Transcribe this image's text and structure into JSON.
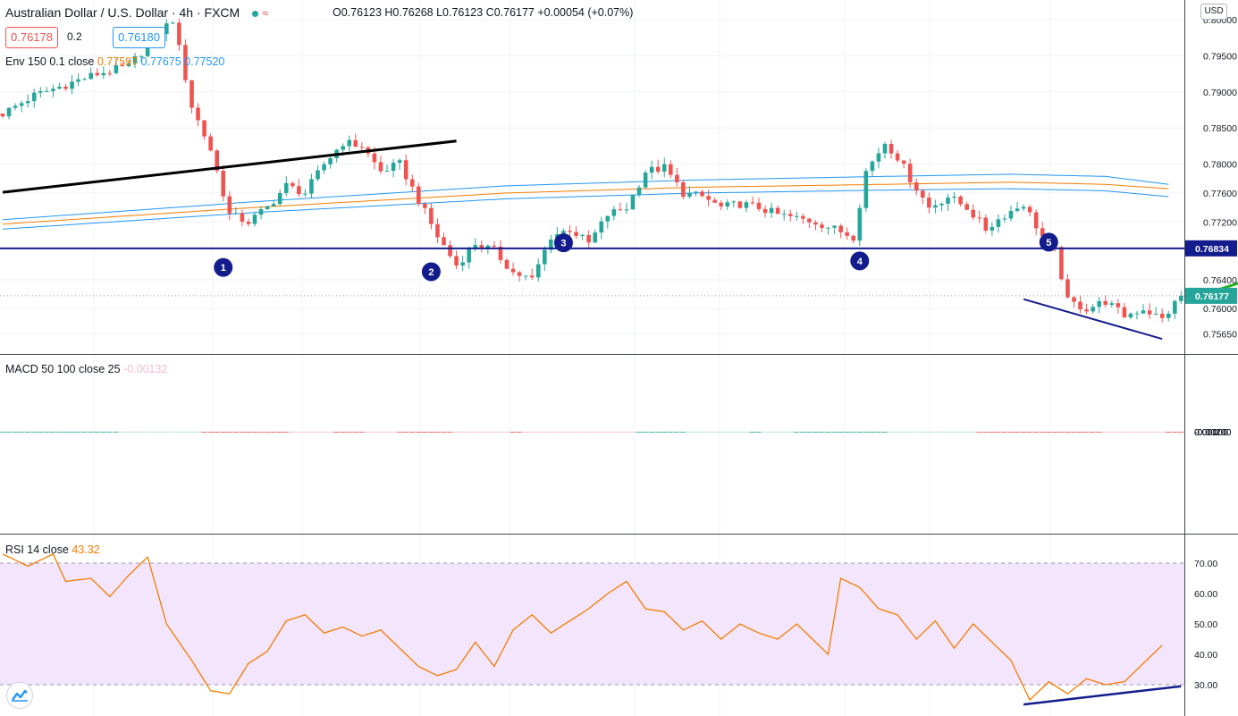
{
  "header": {
    "symbol_title": "Australian Dollar / U.S. Dollar · 4h · FXCM",
    "ohlc": "O0.76123 H0.76268 L0.76123 C0.76177 +0.00054 (+0.07%)",
    "sell_price": "0.76178",
    "spread": "0.2",
    "buy_price": "0.76180",
    "currency": "USD"
  },
  "indicators": {
    "env_label": "Env 150 0.1 close",
    "env_values": [
      "0.77597",
      "0.77675",
      "0.77520"
    ],
    "macd_label": "MACD 50 100 close 25",
    "macd_value": "-0.00132",
    "rsi_label": "RSI 14 close",
    "rsi_value": "43.32"
  },
  "colors": {
    "up": "#26a69a",
    "down": "#ef5350",
    "hist_up_fade": "#b2dfdb",
    "hist_down_fade": "#f8bbd0",
    "envelope_basis": "#f57c00",
    "envelope_bands": "#2196f3",
    "level": "#131c8c",
    "rsi_line": "#f57c00",
    "rsi_band": "#f3e5fc",
    "arrow": "#22b022"
  },
  "chart_data": [
    {
      "type": "candlestick",
      "title": "Australian Dollar / U.S. Dollar · 4h · FXCM",
      "yticks": [
        "0.80000",
        "0.79500",
        "0.79000",
        "0.78500",
        "0.78000",
        "0.77600",
        "0.77200",
        "0.76400",
        "0.76000",
        "0.75650"
      ],
      "ytick_values": [
        0.8,
        0.795,
        0.79,
        0.785,
        0.78,
        0.776,
        0.772,
        0.764,
        0.76,
        0.7565
      ],
      "horizontal_level": 0.76834,
      "horizontal_level_label": "0.76834",
      "last_price": 0.76177,
      "last_price_label": "0.76177",
      "wave_labels": [
        "1",
        "2",
        "3",
        "4",
        "5"
      ],
      "wave_points": [
        [
          35,
          0.7657
        ],
        [
          68,
          0.7651
        ],
        [
          89,
          0.7691
        ],
        [
          136,
          0.7666
        ],
        [
          166,
          0.7692
        ]
      ],
      "trendlines": [
        {
          "from": [
            0,
            0.7761
          ],
          "to": [
            72,
            0.7832
          ],
          "color": "#000000"
        },
        {
          "from": [
            162,
            0.7613
          ],
          "to": [
            184,
            0.7558
          ],
          "color": "#131c8c"
        }
      ],
      "arrow": {
        "from": [
          190,
          0.7618
        ],
        "to": [
          206,
          0.7666
        ]
      },
      "envelope": {
        "basis": [
          0.7717,
          0.774,
          0.776,
          0.7768,
          0.7772,
          0.7775,
          0.7772,
          0.7766
        ],
        "upper": [
          0.7723,
          0.7748,
          0.777,
          0.7778,
          0.7783,
          0.7786,
          0.7783,
          0.7772
        ],
        "lower": [
          0.771,
          0.7733,
          0.7752,
          0.776,
          0.7764,
          0.7766,
          0.7763,
          0.7755
        ],
        "x": [
          0,
          40,
          80,
          110,
          140,
          160,
          175,
          185
        ]
      },
      "price_anchors": [
        [
          0,
          0.787
        ],
        [
          5,
          0.7895
        ],
        [
          10,
          0.791
        ],
        [
          15,
          0.7925
        ],
        [
          20,
          0.7935
        ],
        [
          24,
          0.7975
        ],
        [
          27,
          0.8
        ],
        [
          30,
          0.788
        ],
        [
          33,
          0.782
        ],
        [
          36,
          0.773
        ],
        [
          39,
          0.772
        ],
        [
          42,
          0.774
        ],
        [
          45,
          0.777
        ],
        [
          48,
          0.776
        ],
        [
          51,
          0.78
        ],
        [
          54,
          0.783
        ],
        [
          57,
          0.7825
        ],
        [
          60,
          0.779
        ],
        [
          63,
          0.78
        ],
        [
          66,
          0.775
        ],
        [
          69,
          0.77
        ],
        [
          72,
          0.766
        ],
        [
          75,
          0.769
        ],
        [
          78,
          0.768
        ],
        [
          81,
          0.765
        ],
        [
          84,
          0.764
        ],
        [
          87,
          0.77
        ],
        [
          90,
          0.771
        ],
        [
          93,
          0.769
        ],
        [
          96,
          0.773
        ],
        [
          99,
          0.774
        ],
        [
          102,
          0.779
        ],
        [
          105,
          0.7795
        ],
        [
          108,
          0.776
        ],
        [
          111,
          0.7755
        ],
        [
          114,
          0.774
        ],
        [
          117,
          0.7745
        ],
        [
          120,
          0.774
        ],
        [
          123,
          0.773
        ],
        [
          126,
          0.7725
        ],
        [
          129,
          0.772
        ],
        [
          132,
          0.771
        ],
        [
          135,
          0.77
        ],
        [
          137,
          0.779
        ],
        [
          140,
          0.783
        ],
        [
          142,
          0.781
        ],
        [
          144,
          0.778
        ],
        [
          147,
          0.774
        ],
        [
          150,
          0.7755
        ],
        [
          153,
          0.774
        ],
        [
          156,
          0.771
        ],
        [
          159,
          0.773
        ],
        [
          162,
          0.7745
        ],
        [
          165,
          0.77
        ],
        [
          167,
          0.768
        ],
        [
          169,
          0.761
        ],
        [
          172,
          0.76
        ],
        [
          175,
          0.761
        ],
        [
          178,
          0.759
        ],
        [
          181,
          0.76
        ],
        [
          184,
          0.7585
        ],
        [
          187,
          0.7618
        ]
      ],
      "candles": 188
    },
    {
      "type": "bar",
      "title": "MACD 50 100 close 25",
      "yticks": [
        "0.00100",
        "0.00000",
        "-0.00100",
        "-0.00200"
      ],
      "ytick_values": [
        0.001,
        0,
        -0.001,
        -0.002
      ],
      "histogram_anchors": [
        [
          0,
          0.00082
        ],
        [
          10,
          0.00115
        ],
        [
          18,
          0.00118
        ],
        [
          22,
          0.00112
        ],
        [
          27,
          0.00098
        ],
        [
          31,
          0.00015
        ],
        [
          32,
          -0.00016
        ],
        [
          36,
          -0.0006
        ],
        [
          42,
          -0.00128
        ],
        [
          45,
          -0.0015
        ],
        [
          48,
          -0.0013
        ],
        [
          52,
          -0.0011
        ],
        [
          57,
          -0.00115
        ],
        [
          62,
          -0.0011
        ],
        [
          66,
          -0.0014
        ],
        [
          71,
          -0.0019
        ],
        [
          76,
          -0.0018
        ],
        [
          80,
          -0.0018
        ],
        [
          82,
          -0.002
        ],
        [
          88,
          -0.0013
        ],
        [
          95,
          -0.0005
        ],
        [
          100,
          -0.0002
        ],
        [
          101,
          4e-05
        ],
        [
          108,
          0.00024
        ],
        [
          115,
          0.00018
        ],
        [
          118,
          0.00012
        ],
        [
          120,
          0.00016
        ],
        [
          125,
          0.0001
        ],
        [
          129,
          0.0001
        ],
        [
          133,
          0.0001
        ],
        [
          136,
          0.0005
        ],
        [
          140,
          0.0005
        ],
        [
          145,
          0.00036
        ],
        [
          150,
          0.0002
        ],
        [
          154,
          2e-05
        ],
        [
          156,
          -0.0002
        ],
        [
          162,
          -0.0008
        ],
        [
          168,
          -0.0012
        ],
        [
          174,
          -0.0014
        ],
        [
          178,
          -0.0014
        ],
        [
          184,
          -0.0013
        ],
        [
          187,
          -0.00132
        ]
      ]
    },
    {
      "type": "line",
      "title": "RSI 14 close",
      "yticks": [
        "70.00",
        "60.00",
        "50.00",
        "40.00",
        "30.00"
      ],
      "ytick_values": [
        70,
        60,
        50,
        40,
        30
      ],
      "band": [
        30,
        70
      ],
      "value_anchors": [
        [
          0,
          73
        ],
        [
          4,
          69
        ],
        [
          8,
          73
        ],
        [
          10,
          64
        ],
        [
          14,
          65
        ],
        [
          17,
          59
        ],
        [
          20,
          66
        ],
        [
          23,
          72
        ],
        [
          26,
          50
        ],
        [
          30,
          38
        ],
        [
          33,
          28
        ],
        [
          36,
          27
        ],
        [
          39,
          37
        ],
        [
          42,
          41
        ],
        [
          45,
          51
        ],
        [
          48,
          53
        ],
        [
          51,
          47
        ],
        [
          54,
          49
        ],
        [
          57,
          46
        ],
        [
          60,
          48
        ],
        [
          63,
          42
        ],
        [
          66,
          36
        ],
        [
          69,
          33
        ],
        [
          72,
          35
        ],
        [
          75,
          44
        ],
        [
          78,
          36
        ],
        [
          81,
          48
        ],
        [
          84,
          53
        ],
        [
          87,
          47
        ],
        [
          90,
          51
        ],
        [
          93,
          55
        ],
        [
          96,
          60
        ],
        [
          99,
          64
        ],
        [
          102,
          55
        ],
        [
          105,
          54
        ],
        [
          108,
          48
        ],
        [
          111,
          51
        ],
        [
          114,
          45
        ],
        [
          117,
          50
        ],
        [
          120,
          47
        ],
        [
          123,
          45
        ],
        [
          126,
          50
        ],
        [
          129,
          44
        ],
        [
          131,
          40
        ],
        [
          133,
          65
        ],
        [
          136,
          62
        ],
        [
          139,
          55
        ],
        [
          142,
          53
        ],
        [
          145,
          45
        ],
        [
          148,
          51
        ],
        [
          151,
          42
        ],
        [
          154,
          50
        ],
        [
          157,
          44
        ],
        [
          160,
          38
        ],
        [
          163,
          25
        ],
        [
          166,
          31
        ],
        [
          169,
          27
        ],
        [
          172,
          32
        ],
        [
          175,
          30
        ],
        [
          178,
          31
        ],
        [
          181,
          37
        ],
        [
          184,
          43
        ]
      ],
      "divergence_line": {
        "from": [
          162,
          23.5
        ],
        "to": [
          187,
          29.5
        ],
        "color": "#131c8c"
      }
    }
  ]
}
